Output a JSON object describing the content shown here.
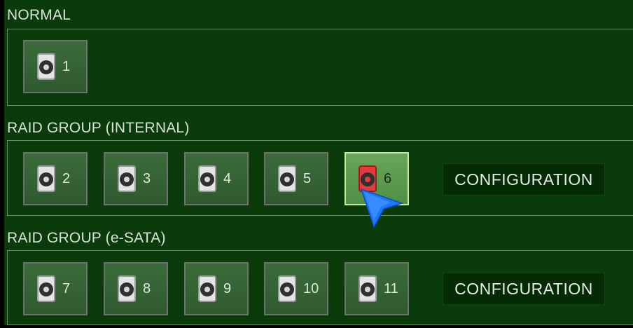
{
  "sections": {
    "normal": {
      "title": "NORMAL"
    },
    "raid_internal": {
      "title": "RAID GROUP (INTERNAL)",
      "config_label": "CONFIGURATION"
    },
    "raid_esata": {
      "title": "RAID GROUP (e-SATA)",
      "config_label": "CONFIGURATION"
    }
  },
  "disks": [
    {
      "id": "1",
      "icon": "hard-disk-icon"
    },
    {
      "id": "2",
      "icon": "hard-disk-icon"
    },
    {
      "id": "3",
      "icon": "hard-disk-icon"
    },
    {
      "id": "4",
      "icon": "hard-disk-icon"
    },
    {
      "id": "5",
      "icon": "hard-disk-icon"
    },
    {
      "id": "6",
      "icon": "hard-disk-icon",
      "selected": true,
      "status_color": "#e23b3b"
    },
    {
      "id": "7",
      "icon": "hard-disk-icon"
    },
    {
      "id": "8",
      "icon": "hard-disk-icon"
    },
    {
      "id": "9",
      "icon": "hard-disk-icon"
    },
    {
      "id": "10",
      "icon": "hard-disk-icon"
    },
    {
      "id": "11",
      "icon": "hard-disk-icon"
    }
  ],
  "colors": {
    "background": "#0b3a0b",
    "selected_disk": "#e23b3b",
    "cursor": "#1e78ff"
  }
}
